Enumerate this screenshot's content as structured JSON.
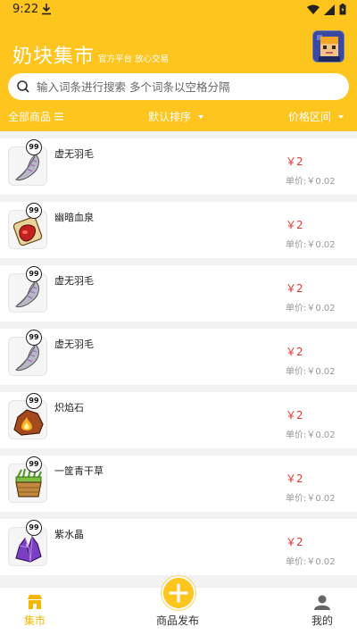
{
  "status_bar": {
    "time": "9:22"
  },
  "header": {
    "title": "奶块集市",
    "subtitle": "官方平台 放心交易",
    "search_placeholder": "输入词条进行搜索 多个词条以空格分隔"
  },
  "filters": {
    "all_goods": "全部商品",
    "sort": "默认排序",
    "price_range": "价格区间"
  },
  "colors": {
    "accent": "#fdc51d",
    "price": "#e53935"
  },
  "items": [
    {
      "name": "虚无羽毛",
      "price": "￥2",
      "unit_price": "单价:￥0.02",
      "qty": "99",
      "icon": "feather-icon"
    },
    {
      "name": "幽暗血泉",
      "price": "￥2",
      "unit_price": "单价:￥0.02",
      "qty": "99",
      "icon": "blood-potion-icon"
    },
    {
      "name": "虚无羽毛",
      "price": "￥2",
      "unit_price": "单价:￥0.02",
      "qty": "99",
      "icon": "feather-icon"
    },
    {
      "name": "虚无羽毛",
      "price": "￥2",
      "unit_price": "单价:￥0.02",
      "qty": "99",
      "icon": "feather-icon"
    },
    {
      "name": "炽焰石",
      "price": "￥2",
      "unit_price": "单价:￥0.02",
      "qty": "99",
      "icon": "flame-stone-icon"
    },
    {
      "name": "一筐青干草",
      "price": "￥2",
      "unit_price": "单价:￥0.02",
      "qty": "99",
      "icon": "hay-basket-icon"
    },
    {
      "name": "紫水晶",
      "price": "￥2",
      "unit_price": "单价:￥0.02",
      "qty": "99",
      "icon": "amethyst-icon"
    }
  ],
  "tabbar": {
    "market": "集市",
    "publish": "商品发布",
    "mine": "我的"
  }
}
